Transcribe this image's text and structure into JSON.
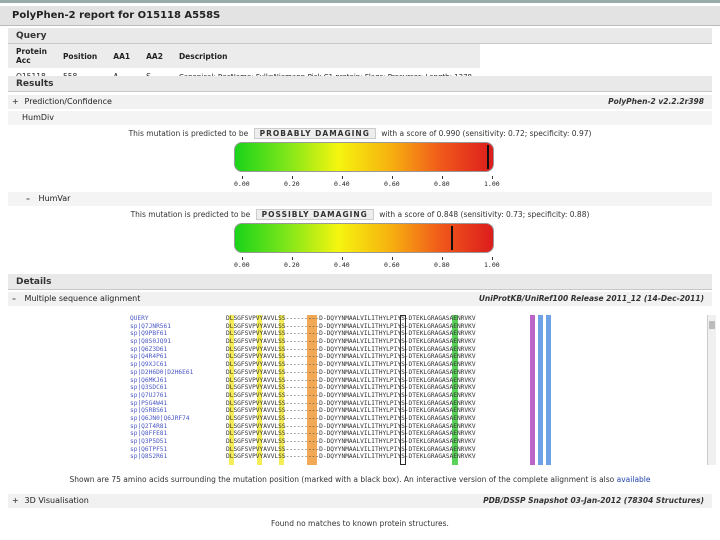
{
  "title": "PolyPhen-2 report for O15118 A558S",
  "query": {
    "header": "Query",
    "columns": [
      "Protein Acc",
      "Position",
      "AA1",
      "AA2",
      "Description"
    ],
    "row": [
      "O15118",
      "558",
      "A",
      "S",
      "Canonical; RecName: Full=Niemann-Pick C1 protein; Flags: Precursor; Length: 1278"
    ]
  },
  "results": {
    "header": "Results",
    "prediction_label": "Prediction/Confidence",
    "version": "PolyPhen-2 v2.2.2r398",
    "humdiv": {
      "label": "HumDiv",
      "text_before": "This mutation is predicted to be",
      "call": "PROBABLY DAMAGING",
      "text_after": "with a score of 0.990 (sensitivity: 0.72; specificity: 0.97)",
      "score": 0.99
    },
    "humvar": {
      "label": "HumVar",
      "text_before": "This mutation is predicted to be",
      "call": "POSSIBLY DAMAGING",
      "text_after": "with a score of 0.848 (sensitivity: 0.73; specificity: 0.88)",
      "score": 0.848
    },
    "ticks": [
      "0.00",
      "0.20",
      "0.40",
      "0.60",
      "0.80",
      "1.00"
    ],
    "gradient_colors": [
      "#19d319",
      "#f5f50f",
      "#dc1c1c"
    ]
  },
  "details": {
    "header": "Details",
    "msa_label": "Multiple sequence alignment",
    "msa_source": "UniProtKB/UniRef100 Release 2011_12 (14-Dec-2011)",
    "alignment_rows": [
      {
        "name": "QUERY",
        "seq": "DLSGFSVPVYAVVLSS---------D-DQYYNMAALVILITHYLPIYS-DTEKLGRAGASAENRVKV"
      },
      {
        "name": "sp|Q7JNR561",
        "seq": "DLSGFSVPVYAVVLSS---------D-DQYYNMAALVILITHYLPIYS-DTEKLGRAGASAENRVKV"
      },
      {
        "name": "sp|Q9PBF61",
        "seq": "DLSGFSVPVYAVVLSS---------D-DQYYNMAALVILITHYLPIYS-DTEKLGRAGASAENRVKV"
      },
      {
        "name": "sp|Q8S0JQ91",
        "seq": "DLSGFSVPVYAVVLSS---------D-DQYYNMAALVILITHYLPIYS-DTEKLGRAGASAENRVKV"
      },
      {
        "name": "sp|Q6Z3D61",
        "seq": "DLSGFSVPVYAVVLSS---------D-DQYYNMAALVILITHYLPIYS-DTEKLGRAGASAENRVKV"
      },
      {
        "name": "sp|Q4R4P61",
        "seq": "DLSGFSVPVYAVVLSS---------D-DQYYNMAALVILITHYLPIYS-DTEKLGRAGASAENRVKV"
      },
      {
        "name": "sp|Q9XJC61",
        "seq": "DLSGFSVPVYAVVLSS---------D-DQYYNMAALVILITHYLPIYS-DTEKLGRAGASAENRVKV"
      },
      {
        "name": "sp|D2H6D0|D2H6E61",
        "seq": "DLSGFSVPVYAVVLSS---------D-DQYYNMAALVILITHYLPIYS-DTEKLGRAGASAENRVKV"
      },
      {
        "name": "sp|Q6MKJ61",
        "seq": "DLSGFSVPVYAVVLSS---------D-DQYYNMAALVILITHYLPIYS-DTEKLGRAGASAENRVKV"
      },
      {
        "name": "sp|Q3SDC61",
        "seq": "DLSGFSVPVYAVVLSS---------D-DQYYNMAALVILITHYLPIYS-DTEKLGRAGASAENRVKV"
      },
      {
        "name": "sp|Q7UJ761",
        "seq": "DLSGFSVPVYAVVLSS---------D-DQYYNMAALVILITHYLPIYS-DTEKLGRAGASAENRVKV"
      },
      {
        "name": "sp|P5G4W41",
        "seq": "DLSGFSVPVYAVVLSS---------D-DQYYNMAALVILITHYLPIYS-DTEKLGRAGASAENRVKV"
      },
      {
        "name": "sp|Q5RBS61",
        "seq": "DLSGFSVPVYAVVLSS---------D-DQYYNMAALVILITHYLPIYS-DTEKLGRAGASAENRVKV"
      },
      {
        "name": "sp|Q6JN0|Q6JRF74",
        "seq": "DLSGFSVPVYAVVLSS---------D-DQYYNMAALVILITHYLPIYS-DTEKLGRAGASAENRVKV"
      },
      {
        "name": "sp|Q2T4R81",
        "seq": "DLSGFSVPVYAVVLSS---------D-DQYYNMAALVILITHYLPIYS-DTEKLGRAGASAENRVKV"
      },
      {
        "name": "sp|Q8FFE81",
        "seq": "DLSGFSVPVYAVVLSS---------D-DQYYNMAALVILITHYLPIYS-DTEKLGRAGASAENRVKV"
      },
      {
        "name": "sp|Q3P5D51",
        "seq": "DLSGFSVPVYAVVLSS---------D-DQYYNMAALVILITHYLPIYS-DTEKLGRAGASAENRVKV"
      },
      {
        "name": "sp|Q6TPF51",
        "seq": "DLSGFSVPVYAVVLSS---------D-DQYYNMAALVILITHYLPIYS-DTEKLGRAGASAENRVKV"
      },
      {
        "name": "sp|Q8S2R61",
        "seq": "DLSGFSVPVYAVVLSS---------D-DQYYNMAALVILITHYLPIYS-DTEKLGRAGASAENRVKV"
      }
    ],
    "note_text": "Shown are 75 amino acids surrounding the mutation position (marked with a black box). An interactive version of the complete alignment is also ",
    "note_link": "available",
    "viz_label": "3D Visualisation",
    "viz_source": "PDB/DSSP Snapshot 03-Jan-2012 (78304 Structures)",
    "viz_note": "Found no matches to known protein structures."
  }
}
